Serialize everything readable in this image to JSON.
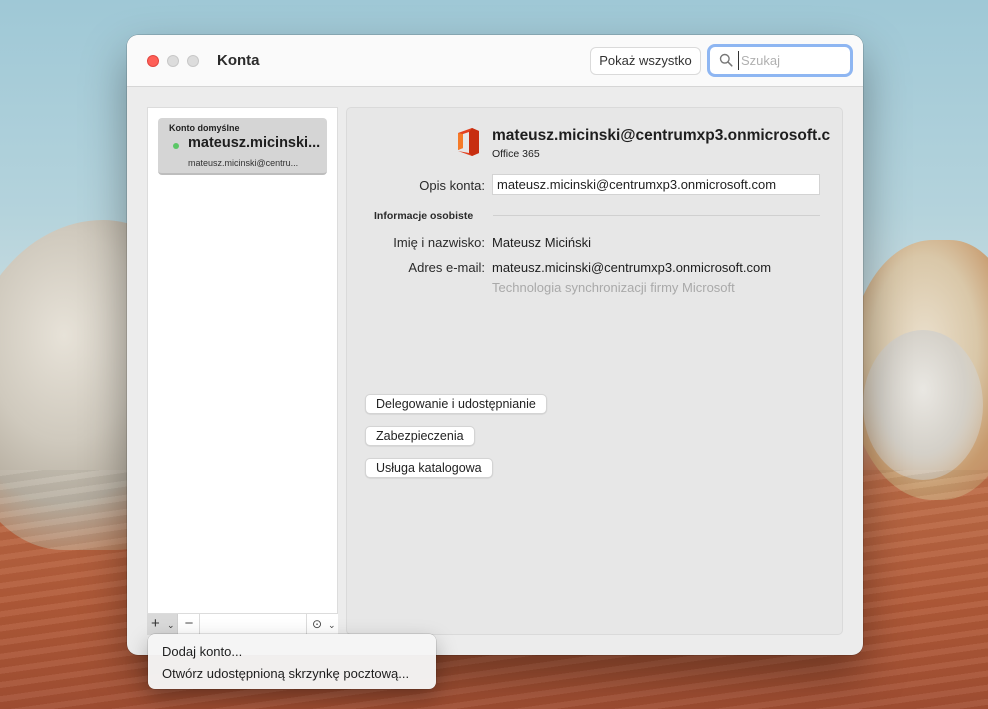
{
  "window": {
    "title": "Konta",
    "show_all_label": "Pokaż wszystko",
    "search_placeholder": "Szukaj"
  },
  "sidebar": {
    "accounts": [
      {
        "group": "Konto domyślne",
        "name": "mateusz.micinski...",
        "email": "mateusz.micinski@centru...",
        "status_color": "#5bc766"
      }
    ],
    "toolbar": {
      "add_symbol": "+",
      "remove_symbol": "−",
      "more_symbol": "⊙"
    }
  },
  "detail": {
    "header_email": "mateusz.micinski@centrumxp3.onmicrosoft.c",
    "account_type": "Office 365",
    "description_label": "Opis konta:",
    "description_value": "mateusz.micinski@centrumxp3.onmicrosoft.com",
    "section_personal": "Informacje osobiste",
    "name_label": "Imię i nazwisko:",
    "name_value": "Mateusz Miciński",
    "email_label": "Adres e-mail:",
    "email_value": "mateusz.micinski@centrumxp3.onmicrosoft.com",
    "sync_hint": "Technologia synchronizacji firmy Microsoft",
    "buttons": {
      "delegation": "Delegowanie i udostępnianie",
      "security": "Zabezpieczenia",
      "directory": "Usługa katalogowa"
    }
  },
  "menu": {
    "items": [
      "Dodaj konto...",
      "Otwórz udostępnioną skrzynkę pocztową..."
    ]
  },
  "colors": {
    "close": "#fe5f57",
    "search_focus": "#8eb6f2",
    "office_brand": "#e2401f"
  }
}
